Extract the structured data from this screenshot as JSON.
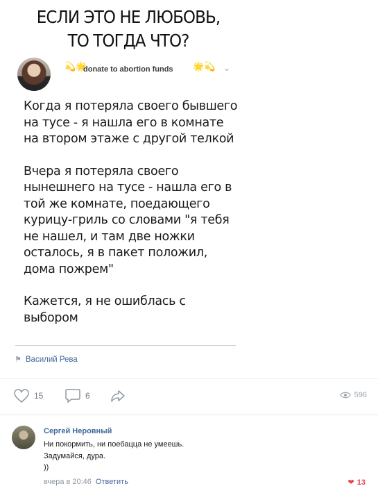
{
  "headline": {
    "line1": "ЕСЛИ ЭТО НЕ ЛЮБОВЬ,",
    "line2": "ТО ТОГДА ЧТО?"
  },
  "post": {
    "author_handle": "donate to abortion funds",
    "decor_left": "💫🌟",
    "decor_right": "🌟💫",
    "paragraphs": [
      "Когда я потеряла своего бывшего на тусе - я нашла его в комнате на втором этаже с другой телкой",
      "Вчера я потеряла своего нынешнего на тусе - нашла его в той же комнате, поедающего курицу-гриль со словами \"я тебя не нашел, и там две ножки осталось, я в пакет положил, дома пожрем\"",
      "Кажется, я не ошиблась с выбором"
    ],
    "source_author": "Василий Рева"
  },
  "actions": {
    "likes": "15",
    "comments": "6",
    "views": "596",
    "icons": {
      "like": "heart-outline-icon",
      "comment": "comment-icon",
      "share": "share-arrow-icon",
      "views": "eye-icon"
    }
  },
  "comment": {
    "author": "Сергей Неровный",
    "lines": [
      "Ни покормить, ни поебацца не умеешь.",
      "Задумайся, дура.",
      "))"
    ],
    "time": "вчера в 20:46",
    "reply_label": "Ответить",
    "likes": "13"
  },
  "colors": {
    "link": "#41699a",
    "muted": "#8d96a0",
    "like_red": "#e64646"
  }
}
